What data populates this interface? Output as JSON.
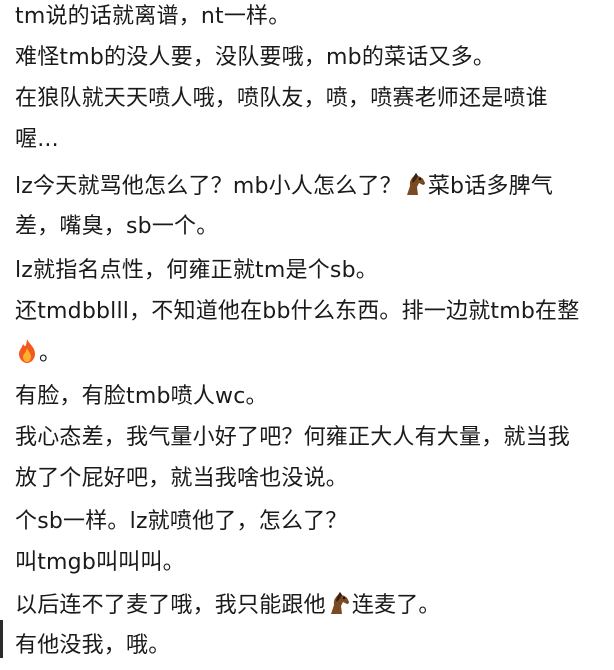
{
  "post": {
    "lines": [
      [
        "tm说的话就离谱，nt一样。"
      ],
      [
        "难怪tmb的没人要，没队要哦，mb的菜话又多。"
      ],
      [
        "在狼队就天天喷人哦，喷队友，喷，喷赛老师还是喷谁"
      ],
      [
        "喔..."
      ],
      [
        "lz今天就骂他怎么了？mb小人怎么了？",
        "菜b话多脾气"
      ],
      [
        "差，嘴臭，sb一个。"
      ],
      [
        "lz就指名点性，何雍正就tm是个sb。"
      ],
      [
        "还tmdbblll，不知道他在bb什么东西。排一边就tmb在整"
      ],
      [
        "。"
      ],
      [
        "有脸，有脸tmb喷人wc。"
      ],
      [
        "我心态差，我气量小好了吧？何雍正大人有大量，就当我"
      ],
      [
        "放了个屁好吧，就当我啥也没说。"
      ],
      [
        "个sb一样。lz就喷他了，怎么了？"
      ],
      [
        "叫tmgb叫叫叫。"
      ],
      [
        "以后连不了麦了哦，我只能跟他",
        "连麦了。"
      ],
      [
        "有他没我，哦。"
      ]
    ],
    "icons": {
      "horse": "horse-emoji",
      "fire": "fire-emoji"
    }
  }
}
